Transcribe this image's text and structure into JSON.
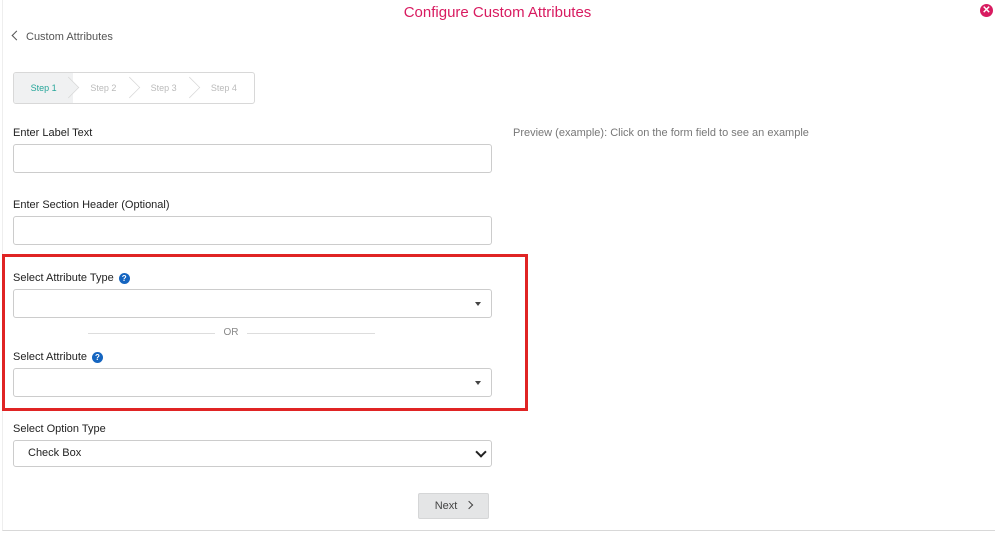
{
  "header": {
    "title": "Configure Custom Attributes",
    "close_icon": "close-circle-icon"
  },
  "back_link": {
    "label": "Custom Attributes"
  },
  "steps": [
    {
      "label": "Step 1",
      "active": true
    },
    {
      "label": "Step 2",
      "active": false
    },
    {
      "label": "Step 3",
      "active": false
    },
    {
      "label": "Step 4",
      "active": false
    }
  ],
  "form": {
    "label_text": {
      "label": "Enter Label Text",
      "value": ""
    },
    "section_header": {
      "label": "Enter Section Header (Optional)",
      "value": ""
    },
    "attribute_type": {
      "label": "Select Attribute Type",
      "value": ""
    },
    "or_text": "OR",
    "attribute": {
      "label": "Select Attribute",
      "value": ""
    },
    "option_type": {
      "label": "Select Option Type",
      "value": "Check Box"
    }
  },
  "preview": {
    "text": "Preview (example): Click on the form field to see an example"
  },
  "footer": {
    "next_label": "Next"
  },
  "colors": {
    "accent": "#d81b60",
    "step_active": "#26a69a",
    "highlight": "#e02424",
    "help": "#1565c0"
  }
}
